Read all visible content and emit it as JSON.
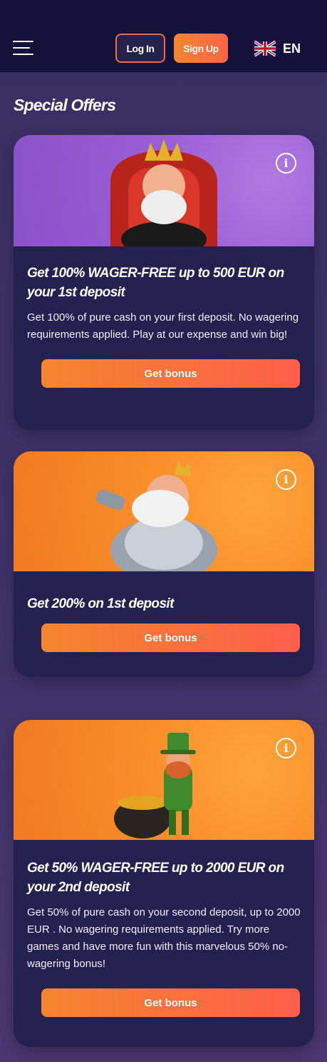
{
  "header": {
    "menu_icon": "hamburger-icon",
    "login": "Log In",
    "signup": "Sign Up",
    "language": "EN",
    "flag_icon": "uk-flag-icon"
  },
  "page_title": "Special Offers",
  "offers": [
    {
      "title": "Get 100% WAGER-FREE up to 500 EUR on your 1st deposit",
      "description": "Get 100% of pure cash on your first deposit. No wagering requirements applied. Play at our expense and win big!",
      "button": "Get bonus"
    },
    {
      "title": "Get 200% on 1st deposit",
      "button": "Get bonus"
    },
    {
      "title": "Get 50% WAGER-FREE up to 2000 EUR on your 2nd deposit",
      "description": "Get 50% of pure cash on your second deposit, up to 2000 EUR . No wagering requirements applied. Try more games and have more fun with this marvelous 50% no-wagering bonus!",
      "button": "Get bonus"
    }
  ],
  "colors": {
    "header_bg": "#14113a",
    "card_bg": "#24204f",
    "accent": "#f5852f",
    "accent2": "#fe5e4a"
  }
}
